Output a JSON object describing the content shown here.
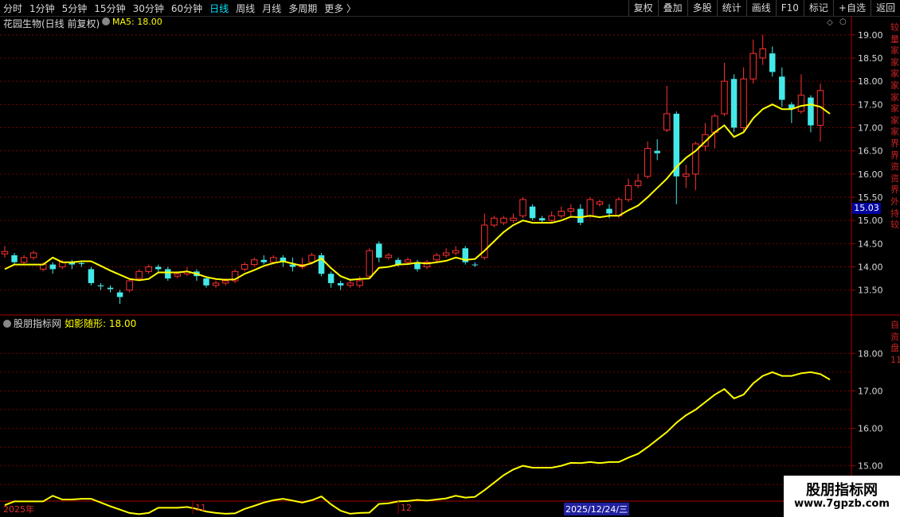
{
  "toolbar": {
    "periods": [
      "分时",
      "1分钟",
      "5分钟",
      "15分钟",
      "30分钟",
      "60分钟",
      "日线",
      "周线",
      "月线",
      "多周期",
      "更多 〉"
    ],
    "active_period": "日线",
    "right": [
      "复权",
      "叠加",
      "多股",
      "统计",
      "画线",
      "F10",
      "标记",
      "+自选",
      "返回"
    ]
  },
  "main_title": "花园生物(日线 前复权)",
  "ma_label": "MA5: 18.00",
  "sub_title": "股朋指标网",
  "sub_indicator": "如影随形: 18.00",
  "price_tag": "15.03",
  "colors": {
    "up": "#ff3030",
    "down": "#44e8e8",
    "ma": "#ffff00",
    "grid": "#7a0000"
  },
  "dates": {
    "year": "2025年",
    "m11": "11",
    "m12": "12",
    "selected": "2025/12/24/三"
  },
  "watermark": {
    "name": "股朋指标网",
    "url": "www.7gpzb.com"
  },
  "right_col_text": "较量家家家家家家家家界界资资界外持较",
  "right_col_text2": "自资盘1111",
  "chart_data": [
    {
      "type": "candlestick",
      "title": "花园生物(日线 前复权)",
      "y_ticks": [
        13.5,
        14.0,
        14.5,
        15.0,
        15.5,
        16.0,
        16.5,
        17.0,
        17.5,
        18.0,
        18.5,
        19.0
      ],
      "ylim": [
        13.1,
        19.1
      ],
      "candles": [
        [
          14.28,
          14.33,
          14.2,
          14.45
        ],
        [
          14.25,
          14.1,
          14.05,
          14.3
        ],
        [
          14.1,
          14.2,
          14.05,
          14.25
        ],
        [
          14.2,
          14.3,
          14.15,
          14.35
        ],
        [
          13.95,
          14.05,
          13.9,
          14.1
        ],
        [
          14.05,
          13.95,
          13.85,
          14.1
        ],
        [
          14.0,
          14.1,
          13.95,
          14.15
        ],
        [
          14.1,
          14.05,
          13.95,
          14.15
        ],
        [
          14.08,
          14.06,
          14.0,
          14.12
        ],
        [
          13.95,
          13.65,
          13.6,
          14.0
        ],
        [
          13.6,
          13.58,
          13.5,
          13.65
        ],
        [
          13.55,
          13.52,
          13.45,
          13.6
        ],
        [
          13.45,
          13.35,
          13.2,
          13.5
        ],
        [
          13.5,
          13.7,
          13.45,
          13.75
        ],
        [
          13.75,
          13.9,
          13.7,
          13.95
        ],
        [
          13.9,
          14.0,
          13.85,
          14.05
        ],
        [
          14.0,
          13.95,
          13.9,
          14.05
        ],
        [
          13.95,
          13.75,
          13.7,
          14.0
        ],
        [
          13.8,
          13.85,
          13.75,
          13.9
        ],
        [
          13.85,
          13.9,
          13.8,
          14.0
        ],
        [
          13.9,
          13.8,
          13.7,
          13.95
        ],
        [
          13.75,
          13.6,
          13.55,
          13.8
        ],
        [
          13.6,
          13.65,
          13.55,
          13.7
        ],
        [
          13.65,
          13.7,
          13.6,
          13.75
        ],
        [
          13.7,
          13.9,
          13.65,
          13.95
        ],
        [
          13.95,
          14.05,
          13.9,
          14.1
        ],
        [
          14.05,
          14.15,
          14.0,
          14.2
        ],
        [
          14.15,
          14.1,
          14.05,
          14.25
        ],
        [
          14.1,
          14.2,
          14.05,
          14.25
        ],
        [
          14.2,
          14.1,
          14.0,
          14.25
        ],
        [
          14.05,
          14.0,
          13.9,
          14.2
        ],
        [
          14.0,
          14.05,
          13.95,
          14.2
        ],
        [
          14.1,
          14.25,
          14.05,
          14.3
        ],
        [
          14.25,
          13.85,
          13.8,
          14.3
        ],
        [
          13.85,
          13.65,
          13.55,
          13.9
        ],
        [
          13.65,
          13.6,
          13.5,
          13.7
        ],
        [
          13.6,
          13.65,
          13.55,
          13.7
        ],
        [
          13.6,
          13.7,
          13.55,
          13.8
        ],
        [
          13.8,
          14.35,
          13.75,
          14.4
        ],
        [
          14.5,
          14.2,
          14.1,
          14.55
        ],
        [
          14.2,
          14.25,
          14.15,
          14.3
        ],
        [
          14.15,
          14.05,
          14.0,
          14.2
        ],
        [
          14.1,
          14.15,
          14.05,
          14.2
        ],
        [
          14.1,
          13.95,
          13.9,
          14.15
        ],
        [
          14.0,
          14.1,
          13.95,
          14.15
        ],
        [
          14.15,
          14.25,
          14.1,
          14.3
        ],
        [
          14.25,
          14.3,
          14.2,
          14.4
        ],
        [
          14.3,
          14.35,
          14.25,
          14.45
        ],
        [
          14.4,
          14.1,
          14.05,
          14.45
        ],
        [
          14.05,
          14.04,
          14.0,
          14.1
        ],
        [
          14.2,
          14.9,
          14.15,
          15.15
        ],
        [
          14.9,
          15.05,
          14.85,
          15.1
        ],
        [
          14.95,
          15.05,
          14.9,
          15.1
        ],
        [
          15.0,
          15.05,
          14.95,
          15.15
        ],
        [
          15.1,
          15.45,
          15.05,
          15.5
        ],
        [
          15.3,
          15.05,
          15.0,
          15.35
        ],
        [
          15.05,
          15.0,
          14.95,
          15.1
        ],
        [
          15.0,
          15.1,
          14.95,
          15.2
        ],
        [
          15.1,
          15.2,
          15.05,
          15.3
        ],
        [
          15.2,
          15.25,
          15.1,
          15.35
        ],
        [
          15.25,
          14.95,
          14.9,
          15.35
        ],
        [
          15.1,
          15.45,
          15.05,
          15.5
        ],
        [
          15.35,
          15.4,
          15.3,
          15.45
        ],
        [
          15.25,
          15.15,
          15.05,
          15.35
        ],
        [
          15.1,
          15.45,
          15.05,
          15.5
        ],
        [
          15.45,
          15.75,
          15.4,
          15.9
        ],
        [
          15.75,
          15.85,
          15.7,
          16.0
        ],
        [
          15.95,
          16.55,
          15.9,
          16.7
        ],
        [
          16.5,
          16.45,
          16.3,
          16.75
        ],
        [
          16.95,
          17.3,
          16.9,
          17.9
        ],
        [
          17.3,
          15.95,
          15.35,
          17.35
        ],
        [
          15.95,
          16.0,
          15.7,
          16.2
        ],
        [
          16.0,
          16.65,
          15.65,
          16.7
        ],
        [
          16.6,
          16.85,
          16.5,
          17.1
        ],
        [
          16.9,
          17.25,
          16.55,
          17.3
        ],
        [
          17.3,
          18.0,
          17.25,
          18.4
        ],
        [
          18.05,
          17.0,
          16.9,
          18.15
        ],
        [
          17.0,
          18.05,
          16.9,
          18.3
        ],
        [
          18.05,
          18.6,
          17.95,
          18.9
        ],
        [
          18.5,
          18.7,
          18.35,
          19.0
        ],
        [
          18.6,
          18.2,
          18.1,
          18.75
        ],
        [
          18.1,
          17.6,
          17.45,
          18.3
        ],
        [
          17.5,
          17.4,
          17.1,
          17.55
        ],
        [
          17.35,
          17.7,
          17.3,
          18.15
        ],
        [
          17.65,
          17.05,
          16.9,
          17.7
        ],
        [
          17.05,
          17.8,
          16.7,
          17.95
        ]
      ],
      "ma5": [
        13.95,
        14.05,
        14.05,
        14.05,
        14.05,
        14.2,
        14.1,
        14.1,
        14.12,
        14.12,
        14.02,
        13.92,
        13.83,
        13.74,
        13.71,
        13.74,
        13.88,
        13.88,
        13.88,
        13.9,
        13.85,
        13.78,
        13.74,
        13.72,
        13.73,
        13.85,
        13.93,
        14.02,
        14.08,
        14.12,
        14.07,
        14.02,
        14.08,
        14.18,
        13.97,
        13.8,
        13.72,
        13.74,
        13.75,
        13.98,
        14.0,
        14.05,
        14.06,
        14.09,
        14.07,
        14.1,
        14.13,
        14.2,
        14.15,
        14.17,
        14.35,
        14.55,
        14.75,
        14.9,
        15.0,
        14.95,
        14.95,
        14.95,
        15.0,
        15.08,
        15.07,
        15.1,
        15.07,
        15.1,
        15.1,
        15.22,
        15.32,
        15.5,
        15.7,
        15.9,
        16.15,
        16.35,
        16.5,
        16.7,
        16.9,
        17.05,
        16.8,
        16.9,
        17.2,
        17.4,
        17.5,
        17.4,
        17.4,
        17.47,
        17.5,
        17.45,
        17.3
      ]
    },
    {
      "type": "line",
      "title": "如影随形: 18.00",
      "series_name": "如影随形",
      "y_ticks": [
        15.0,
        16.0,
        17.0,
        18.0
      ],
      "ylim": [
        14.1,
        18.9
      ],
      "values": "same as ma5"
    }
  ]
}
